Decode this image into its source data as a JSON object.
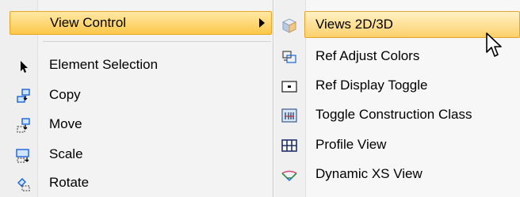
{
  "left_menu": {
    "highlighted": {
      "label": "View Control",
      "has_submenu": true
    },
    "items": [
      {
        "label": "Element Selection",
        "icon": "arrow-pointer-icon"
      },
      {
        "label": "Copy",
        "icon": "copy-element-icon"
      },
      {
        "label": "Move",
        "icon": "move-element-icon"
      },
      {
        "label": "Scale",
        "icon": "scale-element-icon"
      },
      {
        "label": "Rotate",
        "icon": "rotate-element-icon"
      }
    ]
  },
  "submenu": {
    "items": [
      {
        "label": "Views  2D/3D",
        "icon": "views-2d3d-cube-icon",
        "highlighted": true
      },
      {
        "label": "Ref Adjust Colors",
        "icon": "ref-adjust-colors-icon"
      },
      {
        "label": "Ref Display Toggle",
        "icon": "ref-display-toggle-icon"
      },
      {
        "label": "Toggle Construction Class",
        "icon": "toggle-construction-class-icon"
      },
      {
        "label": "Profile View",
        "icon": "profile-view-grid-icon"
      },
      {
        "label": "Dynamic XS View",
        "icon": "dynamic-xs-view-icon"
      }
    ]
  },
  "colors": {
    "highlight_top": "#ffe9a6",
    "highlight_bottom": "#fcc749",
    "highlight_border": "#e8a520"
  }
}
